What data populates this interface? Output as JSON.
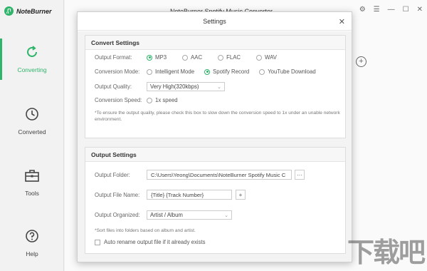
{
  "app": {
    "logo_text": "NoteBurner",
    "window_title": "NoteBurner Spotify Music Converter"
  },
  "sidebar": {
    "items": [
      {
        "label": "Converting",
        "icon": "refresh-icon",
        "active": true
      },
      {
        "label": "Converted",
        "icon": "clock-icon",
        "active": false
      },
      {
        "label": "Tools",
        "icon": "toolbox-icon",
        "active": false
      },
      {
        "label": "Help",
        "icon": "question-icon",
        "active": false
      }
    ]
  },
  "dialog": {
    "title": "Settings",
    "convert": {
      "heading": "Convert Settings",
      "output_format_label": "Output Format:",
      "formats": [
        "MP3",
        "AAC",
        "FLAC",
        "WAV"
      ],
      "selected_format": "MP3",
      "conversion_mode_label": "Conversion Mode:",
      "modes": [
        "Intelligent Mode",
        "Spotify Record",
        "YouTube Download"
      ],
      "selected_mode": "Spotify Record",
      "output_quality_label": "Output Quality:",
      "output_quality_value": "Very High(320kbps)",
      "conversion_speed_label": "Conversion Speed:",
      "speed_option": "1x speed",
      "note": "*To ensure the output quality, please check this box to slow down the conversion speed to 1x under an unable network environment."
    },
    "output": {
      "heading": "Output Settings",
      "folder_label": "Output Folder:",
      "folder_value": "C:\\Users\\Yeong\\Documents\\NoteBurner Spotify Music C",
      "browse_label": "···",
      "file_name_label": "Output File Name:",
      "file_name_value": "{Title} {Track Number}",
      "add_label": "+",
      "organized_label": "Output Organized:",
      "organized_value": "Artist / Album",
      "note": "*Sort files into folders based on album and artist.",
      "auto_rename_label": "Auto rename output file if it already exists"
    }
  },
  "accent_color": "#2fb46a",
  "watermark_text": "下载吧"
}
